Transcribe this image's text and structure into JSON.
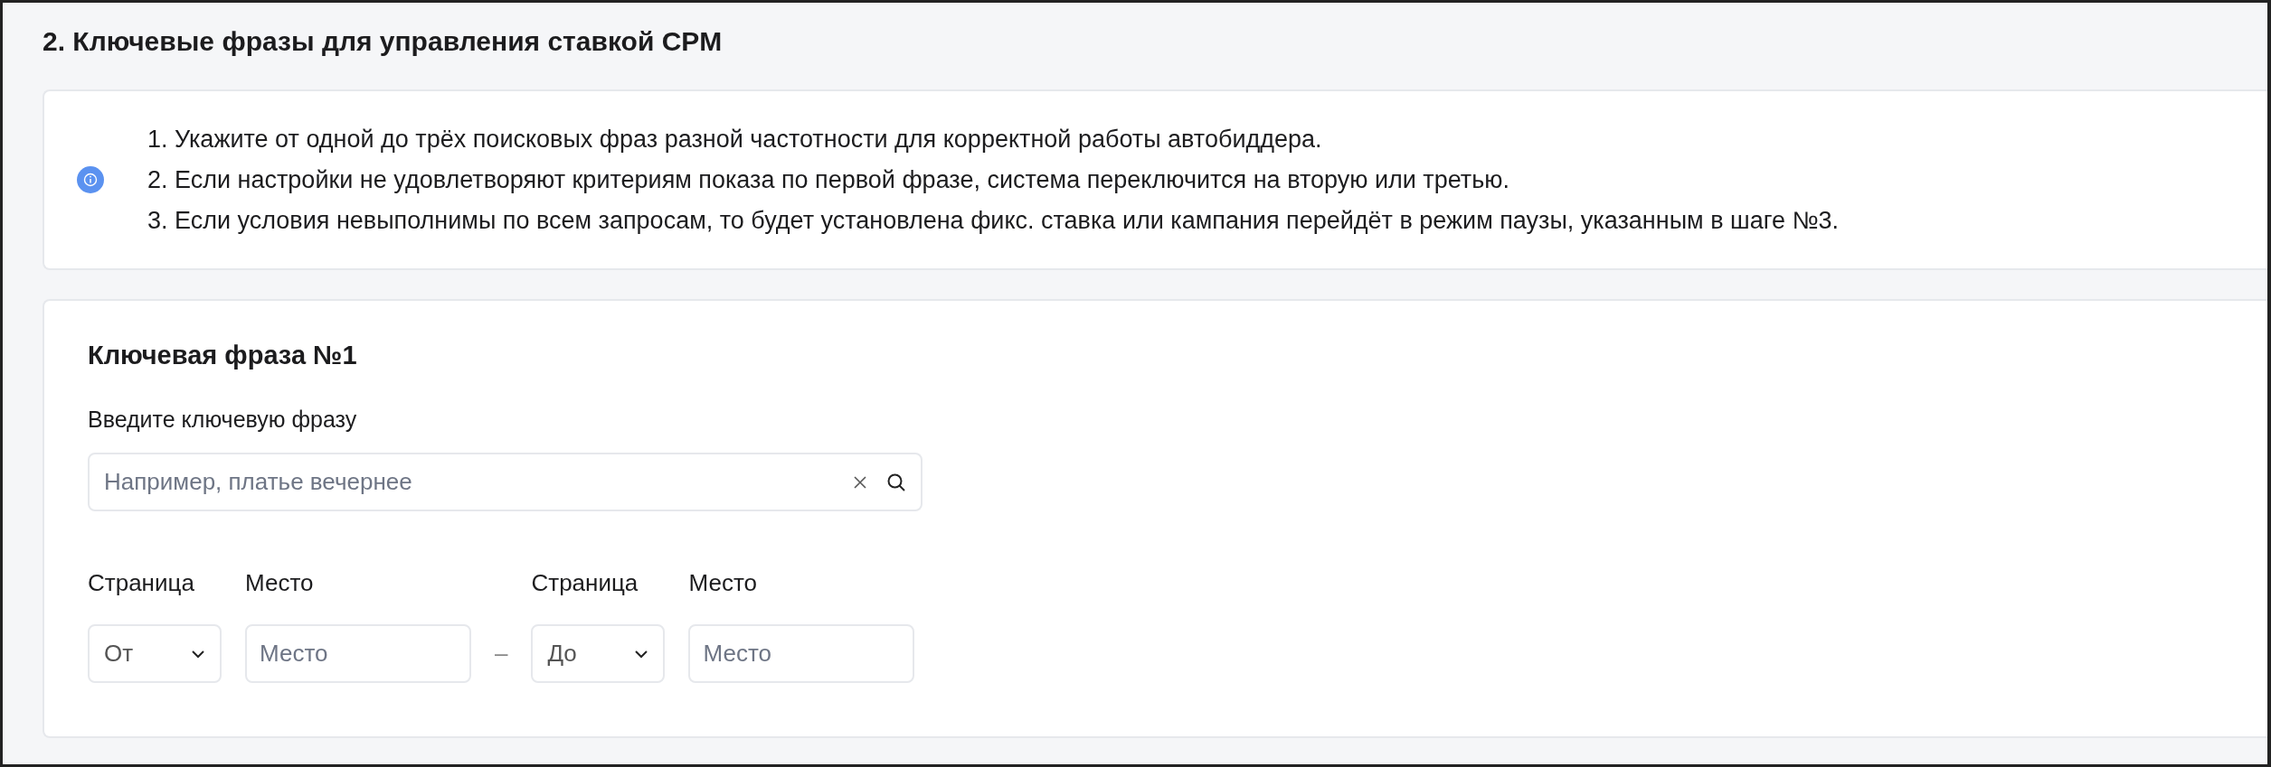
{
  "section_title": "2. Ключевые фразы для управления ставкой CPM",
  "info": {
    "lines": [
      "1. Укажите от одной до трёх поисковых фраз разной частотности для корректной работы автобиддера.",
      "2. Если настройки не удовлетворяют критериям показа по первой фразе, система переключится на вторую или третью.",
      "3. Если условия невыполнимы по всем запросам, то будет установлена фикс. ставка или кампания перейдёт в режим паузы, указанным в шаге №3."
    ]
  },
  "phrase_card": {
    "title": "Ключевая фраза №1",
    "field_label": "Введите ключевую фразу",
    "search": {
      "placeholder": "Например, платье вечернее"
    },
    "range": [
      {
        "page_label": "Страница",
        "page_value": "От",
        "place_label": "Место",
        "place_placeholder": "Место"
      },
      {
        "page_label": "Страница",
        "page_value": "До",
        "place_label": "Место",
        "place_placeholder": "Место"
      }
    ],
    "separator": "–"
  }
}
